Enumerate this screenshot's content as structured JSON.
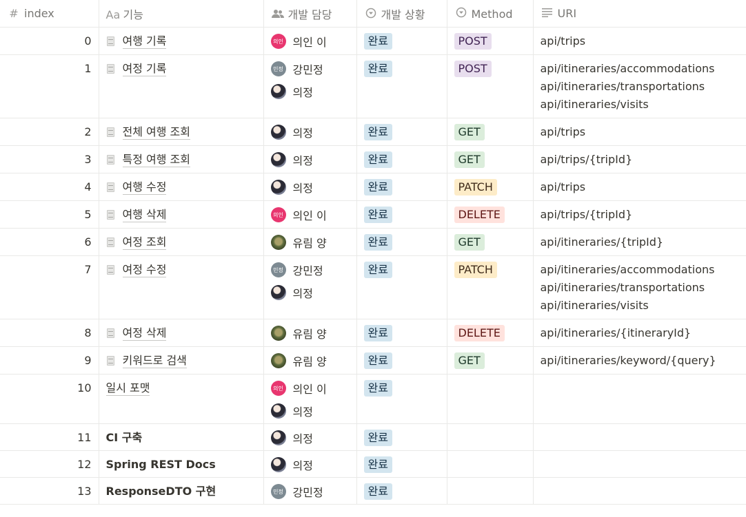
{
  "columns": [
    {
      "label": "index",
      "icon": "#"
    },
    {
      "label": "기능",
      "icon": "Aa"
    },
    {
      "label": "개발 담당",
      "icon": "people-icon"
    },
    {
      "label": "개발 상황",
      "icon": "status-icon"
    },
    {
      "label": "Method",
      "icon": "select-icon"
    },
    {
      "label": "URI",
      "icon": "text-lines-icon"
    }
  ],
  "people": {
    "eui": {
      "name": "의인 이",
      "avatar_text": "의인",
      "avatar": "eui"
    },
    "min": {
      "name": "강민정",
      "avatar_text": "민정",
      "avatar": "min"
    },
    "uij": {
      "name": "의정",
      "avatar_text": "",
      "avatar": "photo"
    },
    "yu": {
      "name": "유림 양",
      "avatar_text": "",
      "avatar": "yu"
    }
  },
  "colors": {
    "done": {
      "bg": "#d3e5ef",
      "fg": "#183347"
    },
    "POST": {
      "bg": "#e8deee",
      "fg": "#412454"
    },
    "GET": {
      "bg": "#dbeddb",
      "fg": "#1c3829"
    },
    "PATCH": {
      "bg": "#fdecc8",
      "fg": "#402c1b"
    },
    "DELETE": {
      "bg": "#ffe2dd",
      "fg": "#5d1715"
    }
  },
  "rows": [
    {
      "index": "0",
      "feature": "여행 기록",
      "doc": true,
      "owners": [
        "eui"
      ],
      "status": "완료",
      "method": "POST",
      "uris": [
        "api/trips"
      ]
    },
    {
      "index": "1",
      "feature": "여정 기록",
      "doc": true,
      "owners": [
        "min",
        "uij"
      ],
      "status": "완료",
      "method": "POST",
      "uris": [
        "api/itineraries/accommodations",
        "api/itineraries/transportations",
        "api/itineraries/visits"
      ]
    },
    {
      "index": "2",
      "feature": "전체 여행 조회",
      "doc": true,
      "owners": [
        "uij"
      ],
      "status": "완료",
      "method": "GET",
      "uris": [
        "api/trips"
      ]
    },
    {
      "index": "3",
      "feature": "특정 여행 조회",
      "doc": true,
      "owners": [
        "uij"
      ],
      "status": "완료",
      "method": "GET",
      "uris": [
        "api/trips/{tripId}"
      ]
    },
    {
      "index": "4",
      "feature": "여행 수정",
      "doc": true,
      "owners": [
        "uij"
      ],
      "status": "완료",
      "method": "PATCH",
      "uris": [
        "api/trips"
      ]
    },
    {
      "index": "5",
      "feature": "여행 삭제",
      "doc": true,
      "owners": [
        "eui"
      ],
      "status": "완료",
      "method": "DELETE",
      "uris": [
        "api/trips/{tripId}"
      ]
    },
    {
      "index": "6",
      "feature": "여정 조회",
      "doc": true,
      "owners": [
        "yu"
      ],
      "status": "완료",
      "method": "GET",
      "uris": [
        "api/itineraries/{tripId}"
      ]
    },
    {
      "index": "7",
      "feature": "여정 수정",
      "doc": true,
      "owners": [
        "min",
        "uij"
      ],
      "status": "완료",
      "method": "PATCH",
      "uris": [
        "api/itineraries/accommodations",
        "api/itineraries/transportations",
        "api/itineraries/visits"
      ]
    },
    {
      "index": "8",
      "feature": "여정 삭제",
      "doc": true,
      "owners": [
        "yu"
      ],
      "status": "완료",
      "method": "DELETE",
      "uris": [
        "api/itineraries/{itineraryId}"
      ]
    },
    {
      "index": "9",
      "feature": "키워드로 검색",
      "doc": true,
      "owners": [
        "yu"
      ],
      "status": "완료",
      "method": "GET",
      "uris": [
        "api/itineraries/keyword/{query}"
      ]
    },
    {
      "index": "10",
      "feature": "일시 포맷",
      "doc": false,
      "bold": false,
      "owners": [
        "eui",
        "uij"
      ],
      "status": "완료",
      "method": "",
      "uris": []
    },
    {
      "index": "11",
      "feature": "CI 구축",
      "doc": false,
      "bold": true,
      "owners": [
        "uij"
      ],
      "status": "완료",
      "method": "",
      "uris": []
    },
    {
      "index": "12",
      "feature": "Spring REST Docs",
      "doc": false,
      "bold": true,
      "owners": [
        "uij"
      ],
      "status": "완료",
      "method": "",
      "uris": []
    },
    {
      "index": "13",
      "feature": "ResponseDTO 구현",
      "doc": false,
      "bold": true,
      "owners": [
        "min"
      ],
      "status": "완료",
      "method": "",
      "uris": []
    }
  ]
}
